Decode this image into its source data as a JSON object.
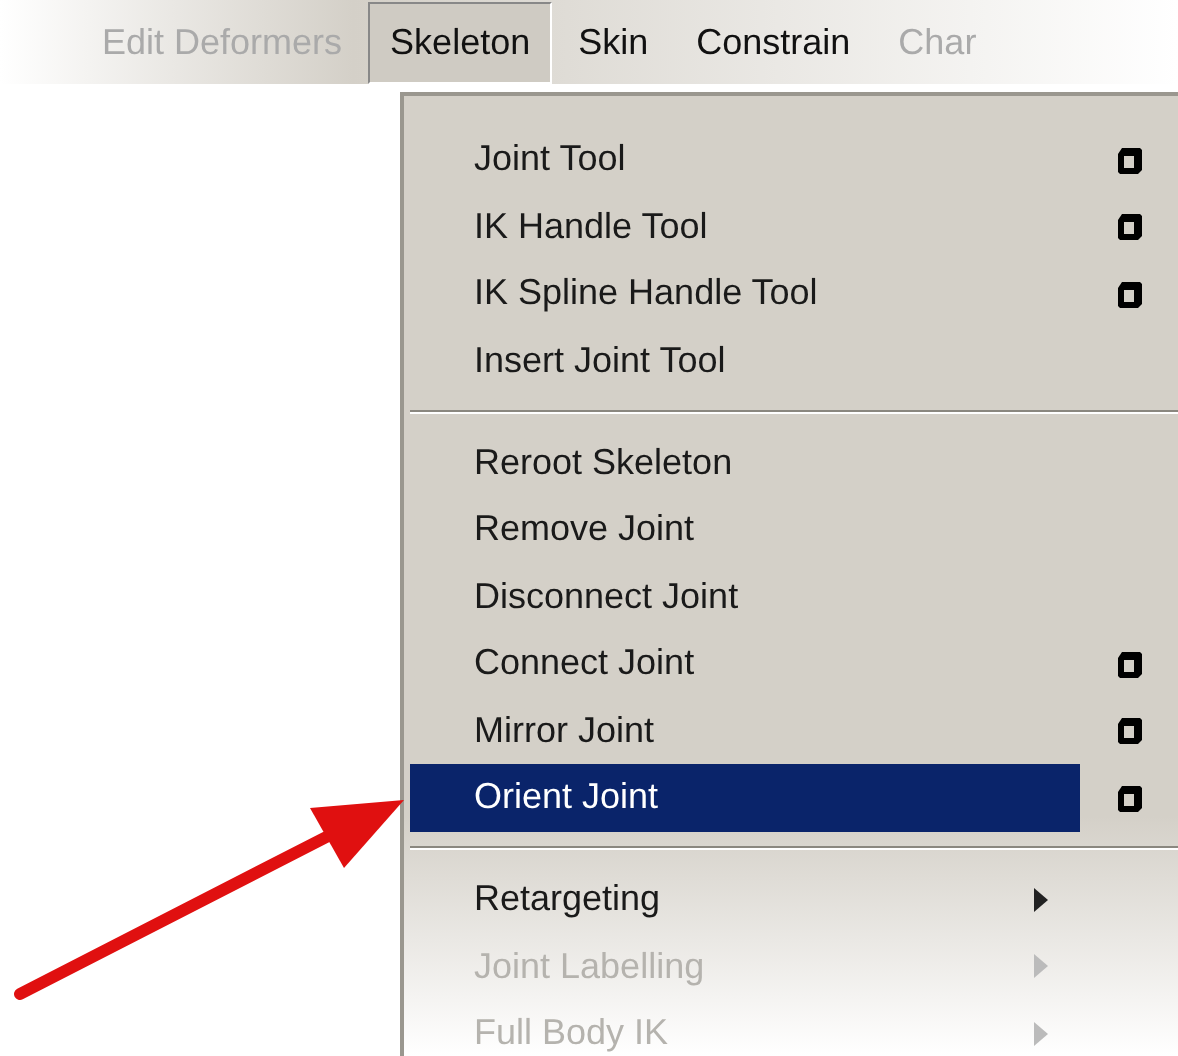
{
  "menubar": [
    {
      "label": "Edit Deformers",
      "selected": false,
      "dimmed": true
    },
    {
      "label": "Skeleton",
      "selected": true,
      "dimmed": false
    },
    {
      "label": "Skin",
      "selected": false,
      "dimmed": false
    },
    {
      "label": "Constrain",
      "selected": false,
      "dimmed": false
    },
    {
      "label": "Char",
      "selected": false,
      "dimmed": true
    }
  ],
  "menu": {
    "sections": [
      [
        {
          "label": "Joint Tool",
          "kind": "option",
          "selected": false,
          "dimmed": false
        },
        {
          "label": "IK Handle Tool",
          "kind": "option",
          "selected": false,
          "dimmed": false
        },
        {
          "label": "IK Spline Handle Tool",
          "kind": "option",
          "selected": false,
          "dimmed": false
        },
        {
          "label": "Insert Joint Tool",
          "kind": "plain",
          "selected": false,
          "dimmed": false
        }
      ],
      [
        {
          "label": "Reroot Skeleton",
          "kind": "plain",
          "selected": false,
          "dimmed": false
        },
        {
          "label": "Remove Joint",
          "kind": "plain",
          "selected": false,
          "dimmed": false
        },
        {
          "label": "Disconnect Joint",
          "kind": "plain",
          "selected": false,
          "dimmed": false
        },
        {
          "label": "Connect Joint",
          "kind": "option",
          "selected": false,
          "dimmed": false
        },
        {
          "label": "Mirror Joint",
          "kind": "option",
          "selected": false,
          "dimmed": false
        },
        {
          "label": "Orient Joint",
          "kind": "option",
          "selected": true,
          "dimmed": false
        }
      ],
      [
        {
          "label": "Retargeting",
          "kind": "submenu",
          "selected": false,
          "dimmed": false
        },
        {
          "label": "Joint Labelling",
          "kind": "submenu",
          "selected": false,
          "dimmed": true
        },
        {
          "label": "Full Body IK",
          "kind": "submenu",
          "selected": false,
          "dimmed": true
        }
      ]
    ]
  }
}
